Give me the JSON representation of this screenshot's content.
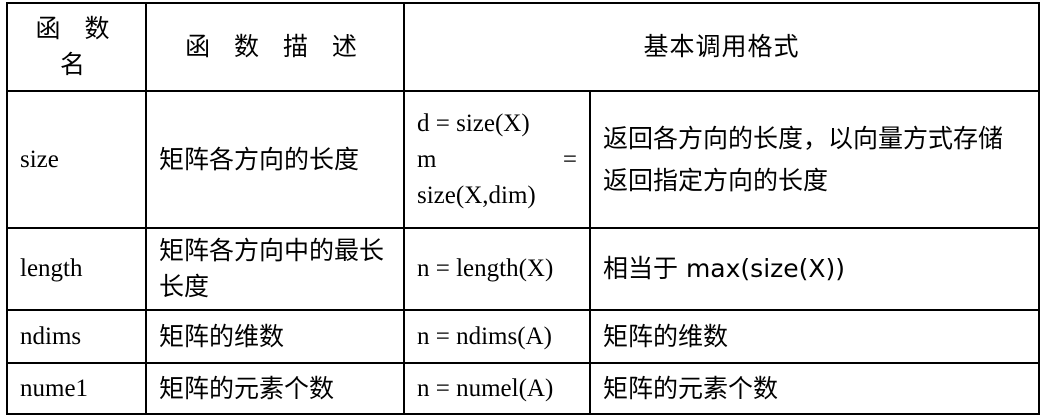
{
  "header": {
    "name": "函 数 名",
    "description": "函 数 描 述",
    "call_format": "基本调用格式"
  },
  "rows": [
    {
      "name": "size",
      "description": "矩阵各方向的长度",
      "calls": [
        "d = size(X)",
        "m",
        "=",
        "size(X,dim)"
      ],
      "notes": [
        "返回各方向的长度，以向量方式存储",
        "返回指定方向的长度"
      ]
    },
    {
      "name": "length",
      "description": "矩阵各方向中的最长长度",
      "calls": [
        "n = length(X)"
      ],
      "notes": [
        "相当于 max(size(X))"
      ]
    },
    {
      "name": "ndims",
      "description": "矩阵的维数",
      "calls": [
        "n = ndims(A)"
      ],
      "notes": [
        "矩阵的维数"
      ]
    },
    {
      "name": "nume1",
      "description": "矩阵的元素个数",
      "calls": [
        "n = numel(A)"
      ],
      "notes": [
        "矩阵的元素个数"
      ]
    }
  ]
}
